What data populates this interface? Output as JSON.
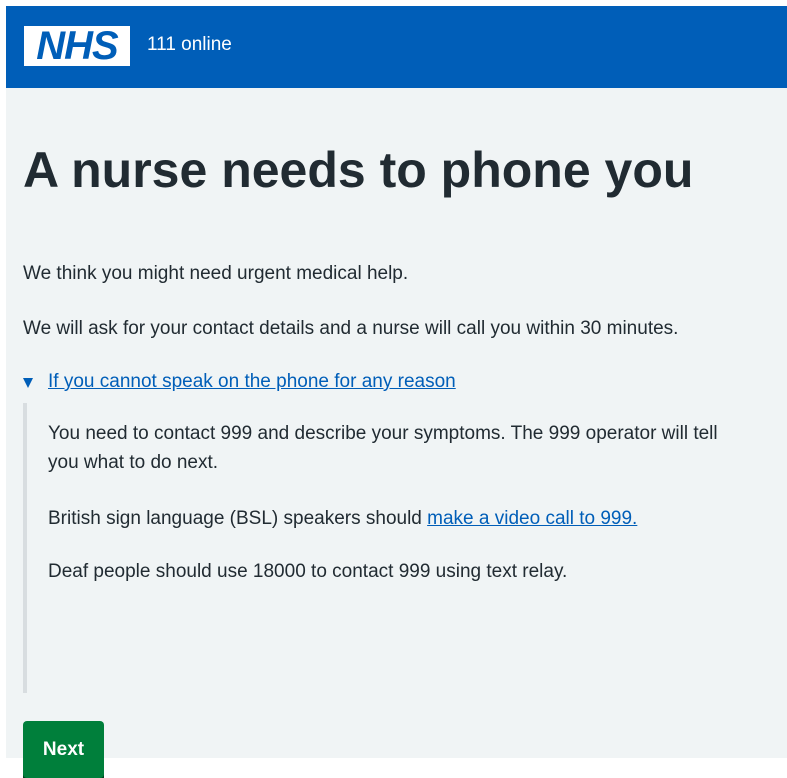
{
  "header": {
    "logo_text": "NHS",
    "service_name": "111 online"
  },
  "main": {
    "title": "A nurse needs to phone you",
    "paragraphs": [
      "We think you might need urgent medical help.",
      "We will ask for your contact details and a nurse will call you within 30 minutes."
    ],
    "details": {
      "summary": "If you cannot speak on the phone for any reason",
      "body_1": "You need to contact 999 and describe your symptoms. The 999 operator will tell you what to do next.",
      "body_2_prefix": "British sign language (BSL) speakers should ",
      "body_2_link": "make a video call to 999.",
      "body_3": "Deaf people should use 18000 to contact 999 using text relay."
    },
    "next_label": "Next"
  },
  "colors": {
    "nhs_blue": "#005eb8",
    "background": "#f0f4f5",
    "button_green": "#007f3b",
    "text": "#212b32"
  }
}
